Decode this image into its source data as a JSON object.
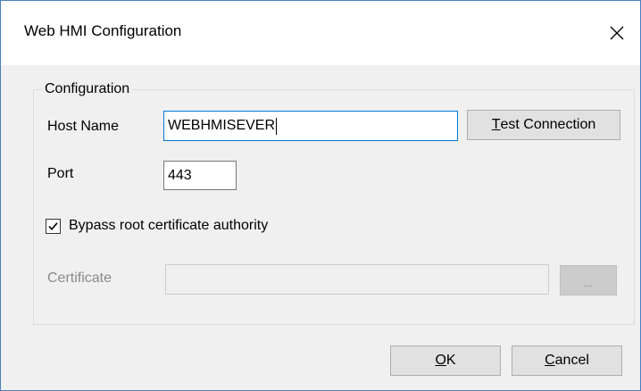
{
  "window": {
    "title": "Web HMI Configuration",
    "close_icon": "close-icon"
  },
  "group": {
    "legend": "Configuration"
  },
  "host": {
    "label": "Host Name",
    "value": "WEBHMISEVER"
  },
  "test_connection": {
    "mnemonic": "T",
    "rest": "est Connection"
  },
  "port": {
    "label": "Port",
    "value": "443"
  },
  "bypass": {
    "label": "Bypass root certificate authority",
    "checked": true
  },
  "certificate": {
    "label": "Certificate",
    "value": "",
    "browse_label": "..."
  },
  "ok": {
    "mnemonic": "O",
    "rest": "K"
  },
  "cancel": {
    "mnemonic": "C",
    "rest": "ancel"
  },
  "colors": {
    "focus_border": "#0078d7",
    "window_border": "#4a7fc1",
    "dialog_background": "#f0f0f0",
    "disabled_text": "#8a8a8a"
  }
}
